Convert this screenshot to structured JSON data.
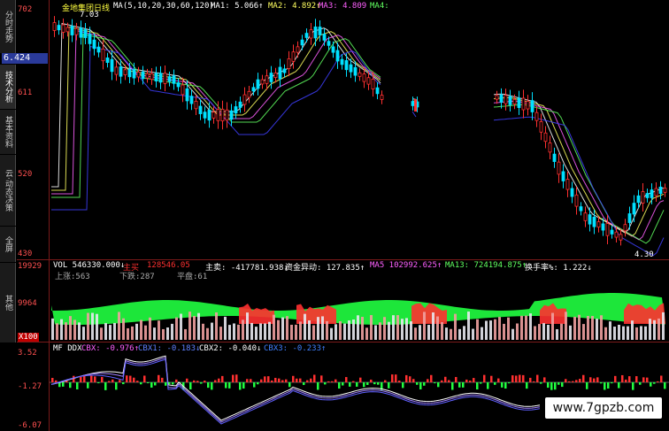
{
  "sidebar": {
    "items": [
      {
        "label": "分时走势"
      },
      {
        "label": "技术分析"
      },
      {
        "label": "基本资料"
      },
      {
        "label": "云·动态决策"
      },
      {
        "label": "全屏"
      },
      {
        "label": "其他"
      }
    ],
    "active_price": "6.424"
  },
  "main_panel": {
    "stock_name": "金地集团",
    "period": "日线",
    "ma_params": "MA(5,10,20,30,60,120)",
    "ma1": "MA1: 5.066↑",
    "ma2": "MA2: 4.892↑",
    "ma3": "MA3: 4.809",
    "ma4": "MA4:",
    "high_mark": "7.03",
    "low_mark": "4.30",
    "y_labels": [
      "702",
      "611",
      "520",
      "430"
    ]
  },
  "volume_panel": {
    "vol": "VOL 546330.000↓",
    "main_buy_label": "主买",
    "main_buy_value": "128546.05",
    "main_sell": "主卖: -417781.938↓",
    "fund_flow": "资金异动: 127.835↑",
    "ma5": "MA5 102992.625↑",
    "ma13": "MA13: 724194.875↑",
    "turnover": "换手率%: 1.222↓",
    "up_count": "上涨:563",
    "down_count": "下跌:287",
    "flat_count": "平盘:61",
    "y_labels": [
      "19929",
      "9964"
    ],
    "unit": "X100"
  },
  "ddx_panel": {
    "title": "MF DDX",
    "cbx": "CBX: -0.976↑",
    "cbx1": "CBX1: -0.183↓",
    "cbx2": "CBX2: -0.040↓",
    "cbx3": "CBX3: -0.233↑",
    "y_labels": [
      "3.52",
      "-1.27",
      "-6.07"
    ]
  },
  "watermark": "www.7gpzb.com",
  "colors": {
    "up": "#ff3030",
    "down": "#00e0ff",
    "ma1": "#ffffff",
    "ma2": "#ffff60",
    "ma3": "#ff60ff",
    "ma4": "#60ff60",
    "ma6": "#4040ff",
    "vol_green": "#20ff40",
    "vol_red": "#ff3030",
    "axis": "#7a1a1a"
  }
}
